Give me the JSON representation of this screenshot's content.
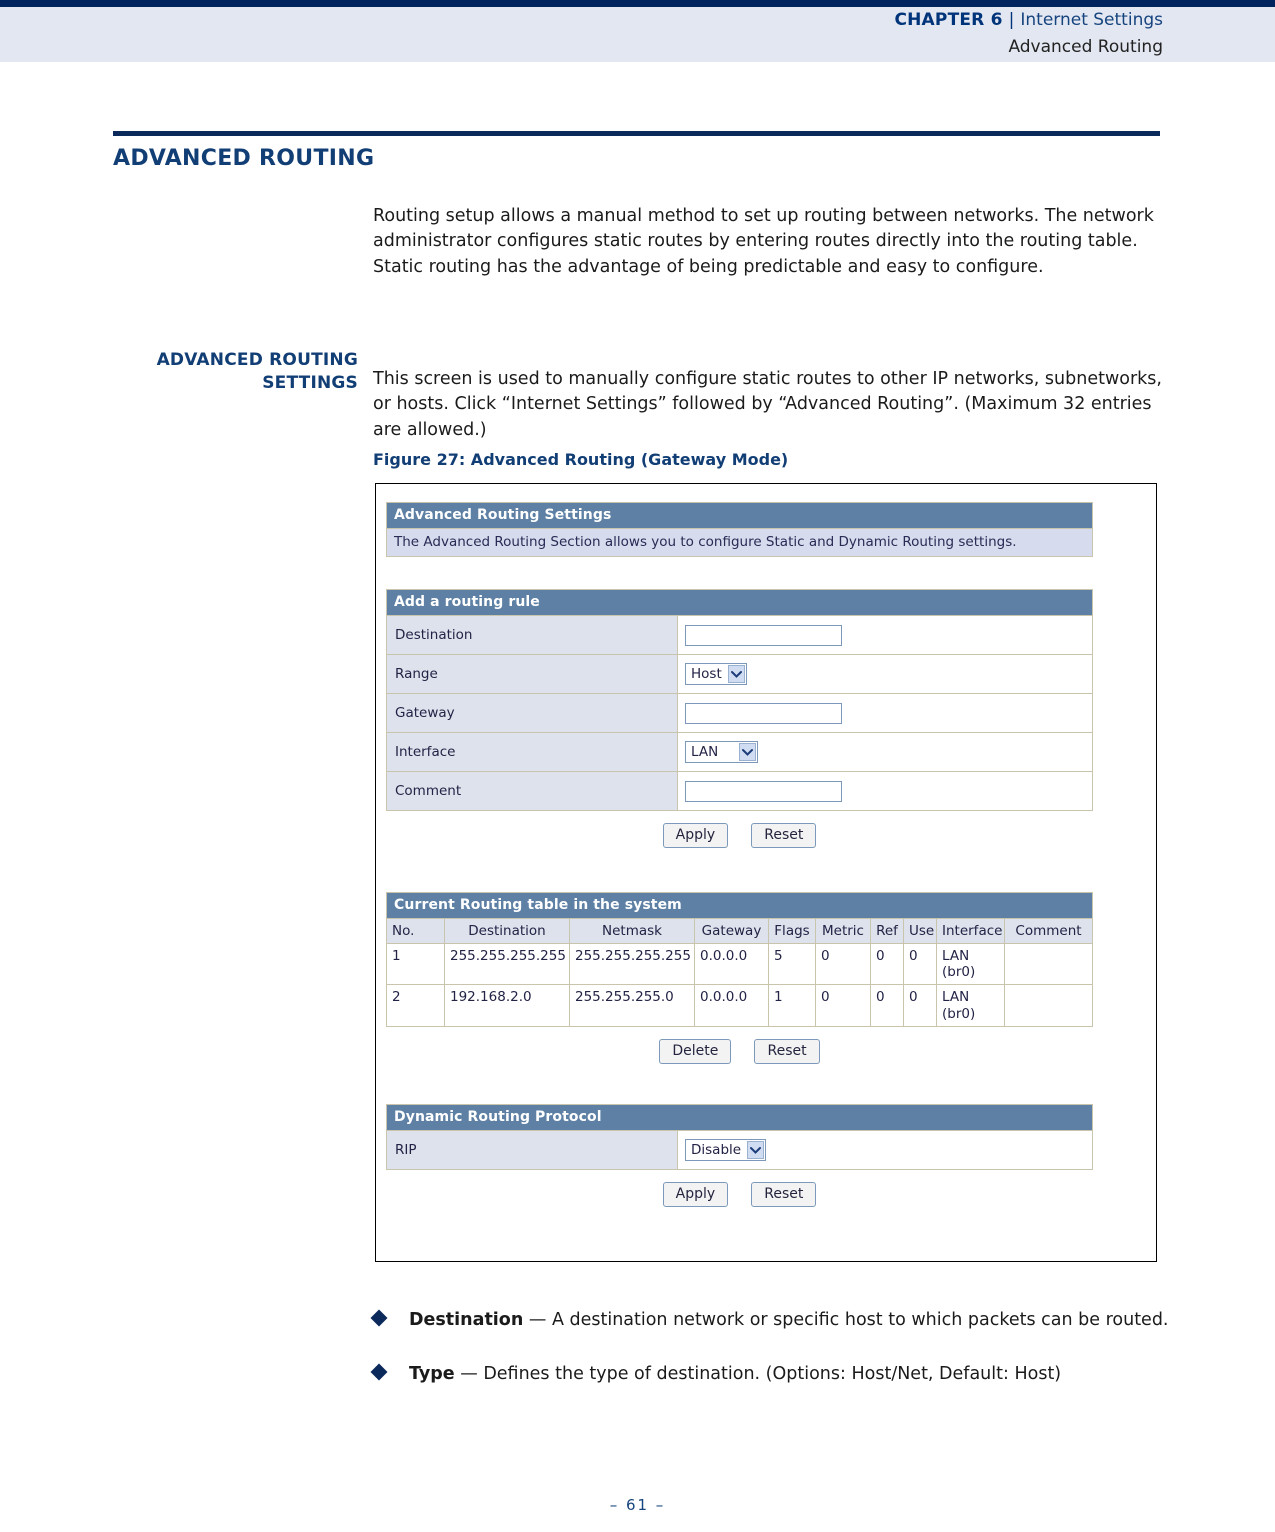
{
  "header": {
    "chapter_label": "CHAPTER 6",
    "separator": "|",
    "chapter_title": "Internet Settings",
    "subtitle": "Advanced Routing"
  },
  "section": {
    "title": "ADVANCED ROUTING",
    "intro": "Routing setup allows a manual method to set up routing between networks. The network administrator configures static routes by entering routes directly into the routing table. Static routing has the advantage of being predictable and easy to configure."
  },
  "subsection": {
    "side_head_line1": "ADVANCED ROUTING",
    "side_head_line2": "SETTINGS",
    "body": "This screen is used to manually configure static routes to other IP networks, subnetworks, or hosts. Click “Internet Settings” followed by “Advanced Routing”. (Maximum 32 entries are allowed.)",
    "figure_caption": "Figure 27:  Advanced Routing (Gateway Mode)"
  },
  "figure": {
    "settings_panel": {
      "title": "Advanced Routing Settings",
      "description": "The Advanced Routing Section allows you to configure Static and Dynamic Routing settings."
    },
    "add_rule_panel": {
      "title": "Add a routing rule",
      "fields": [
        {
          "label": "Destination",
          "type": "text",
          "value": ""
        },
        {
          "label": "Range",
          "type": "select",
          "value": "Host"
        },
        {
          "label": "Gateway",
          "type": "text",
          "value": ""
        },
        {
          "label": "Interface",
          "type": "select",
          "value": "LAN"
        },
        {
          "label": "Comment",
          "type": "text",
          "value": ""
        }
      ],
      "apply_label": "Apply",
      "reset_label": "Reset"
    },
    "routing_table_panel": {
      "title": "Current Routing table in the system",
      "columns": [
        "No.",
        "Destination",
        "Netmask",
        "Gateway",
        "Flags",
        "Metric",
        "Ref",
        "Use",
        "Interface",
        "Comment"
      ],
      "rows": [
        {
          "no": "1",
          "destination": "255.255.255.255",
          "netmask": "255.255.255.255",
          "gateway": "0.0.0.0",
          "flags": "5",
          "metric": "0",
          "ref": "0",
          "use": "0",
          "interface": "LAN (br0)",
          "comment": ""
        },
        {
          "no": "2",
          "destination": "192.168.2.0",
          "netmask": "255.255.255.0",
          "gateway": "0.0.0.0",
          "flags": "1",
          "metric": "0",
          "ref": "0",
          "use": "0",
          "interface": "LAN (br0)",
          "comment": ""
        }
      ],
      "delete_label": "Delete",
      "reset_label": "Reset"
    },
    "dynamic_panel": {
      "title": "Dynamic Routing Protocol",
      "rip_label": "RIP",
      "rip_value": "Disable",
      "apply_label": "Apply",
      "reset_label": "Reset"
    }
  },
  "bullets": [
    {
      "term": "Destination",
      "dash": " — ",
      "text": "A destination network or specific host to which packets can be routed."
    },
    {
      "term": "Type",
      "dash": " — ",
      "text": "Defines the type of destination. (Options: Host/Net, Default: Host)"
    }
  ],
  "footer": {
    "page_number": "–  61  –"
  },
  "colors": {
    "navy_rule": "#00245e",
    "header_band": "#e3e7f2",
    "heading_blue": "#123e76",
    "panel_header": "#5d80a4",
    "panel_desc_bg": "#d6dced",
    "label_cell_bg": "#dde2ec"
  }
}
